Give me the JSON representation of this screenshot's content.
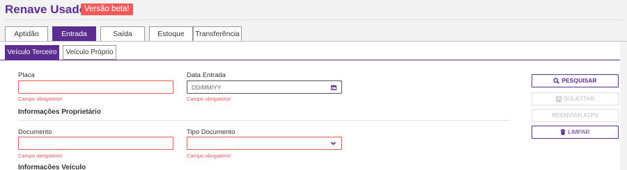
{
  "header": {
    "title": "Renave Usado",
    "badge": "Versão beta!"
  },
  "tabs": [
    {
      "label": "Aptidão",
      "active": false
    },
    {
      "label": "Entrada",
      "active": true
    },
    {
      "label": "Saída",
      "active": false
    },
    {
      "label": "Estoque",
      "active": false
    },
    {
      "label": "Transferência",
      "active": false
    }
  ],
  "subtabs": [
    {
      "label": "Veículo Terceiro",
      "active": true
    },
    {
      "label": "Veículo Próprio",
      "active": false
    }
  ],
  "form": {
    "placa": {
      "label": "Placa",
      "value": "",
      "error": "Campo obrigatório!"
    },
    "data_entrada": {
      "label": "Data Entrada",
      "placeholder": "DD/MM/YY",
      "error": "Campo obrigatório!"
    },
    "section_proprietario": "Informações Proprietário",
    "documento": {
      "label": "Documento",
      "value": "",
      "error": "Campo obrigatório!"
    },
    "tipo_documento": {
      "label": "Tipo Documento",
      "value": "",
      "error": "Campo obrigatório!"
    },
    "section_veiculo": "Informações Veículo"
  },
  "actions": {
    "pesquisar": "PESQUISAR",
    "solicitar": "SOLICITAR",
    "reenviar": "REENVIAR ATPV",
    "limpar": "LIMPAR"
  },
  "colors": {
    "brand": "#5c2d91",
    "error": "#e05656",
    "badge": "#f05a5a"
  },
  "icons": {
    "pesquisar": "search-icon",
    "solicitar": "save-icon",
    "limpar": "trash-icon",
    "data": "calendar-icon",
    "tipo": "chevron-down-icon"
  }
}
